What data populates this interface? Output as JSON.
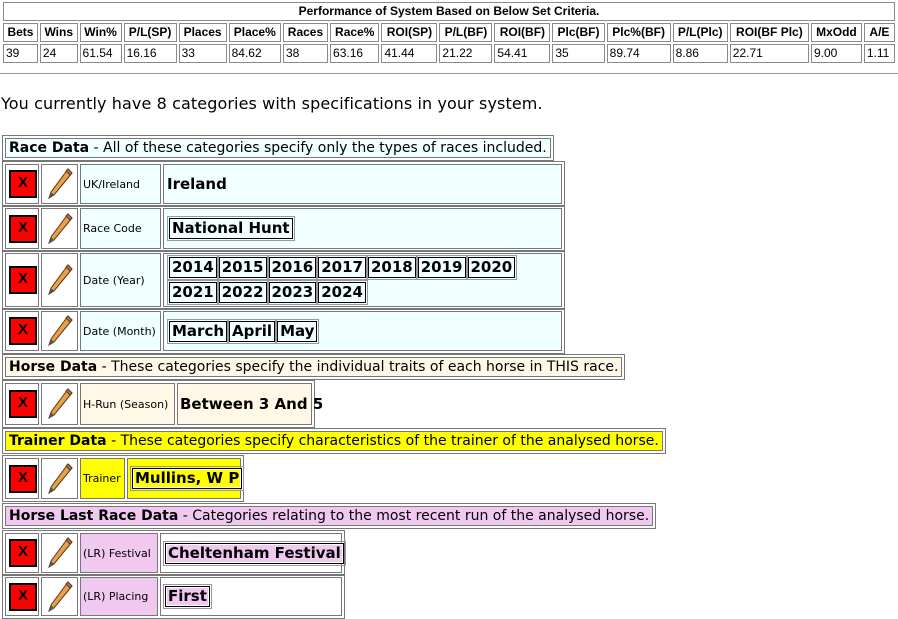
{
  "performance": {
    "caption": "Performance of System Based on Below Set Criteria.",
    "headers": [
      "Bets",
      "Wins",
      "Win%",
      "P/L(SP)",
      "Places",
      "Place%",
      "Races",
      "Race%",
      "ROI(SP)",
      "P/L(BF)",
      "ROI(BF)",
      "Plc(BF)",
      "Plc%(BF)",
      "P/L(Plc)",
      "ROI(BF Plc)",
      "MxOdd",
      "A/E"
    ],
    "values": [
      "39",
      "24",
      "61.54",
      "16.16",
      "33",
      "84.62",
      "38",
      "63.16",
      "41.44",
      "21.22",
      "54.41",
      "35",
      "89.74",
      "8.86",
      "22.71",
      "9.00",
      "1.11"
    ]
  },
  "summary": "You currently have 8 categories with specifications in your system.",
  "sections": {
    "race": {
      "title": "Race Data",
      "desc": " - All of these categories specify only the types of races included."
    },
    "horse": {
      "title": "Horse Data",
      "desc": " - These categories specify the individual traits of each horse in THIS race."
    },
    "trainer": {
      "title": "Trainer Data",
      "desc": " - These categories specify characteristics of the trainer of the analysed horse."
    },
    "last": {
      "title": "Horse Last Race Data",
      "desc": " - Categories relating to the most recent run of the analysed horse."
    }
  },
  "delete_label": "X",
  "categories": {
    "uk_ireland": {
      "label": "UK/Ireland",
      "value": "Ireland"
    },
    "race_code": {
      "label": "Race Code",
      "value": "National Hunt"
    },
    "date_year": {
      "label": "Date (Year)",
      "values": [
        "2014",
        "2015",
        "2016",
        "2017",
        "2018",
        "2019",
        "2020",
        "2021",
        "2022",
        "2023",
        "2024"
      ]
    },
    "date_month": {
      "label": "Date (Month)",
      "values": [
        "March",
        "April",
        "May"
      ]
    },
    "h_run": {
      "label": "H-Run (Season)",
      "prefix": "Between ",
      "low": "3",
      "mid": " And ",
      "high": "5"
    },
    "trainer": {
      "label": "Trainer",
      "value": "Mullins, W P"
    },
    "lr_festival": {
      "label": "(LR) Festival",
      "value": "Cheltenham Festival"
    },
    "lr_placing": {
      "label": "(LR) Placing",
      "value": "First"
    }
  },
  "icons": {
    "delete": "x-box-icon",
    "edit": "pencil-icon"
  },
  "colors": {
    "race": "#f0ffff",
    "horse": "#fff8e7",
    "trainer": "#ffff00",
    "last": "#f0c8f0",
    "delete": "#ff0000"
  }
}
